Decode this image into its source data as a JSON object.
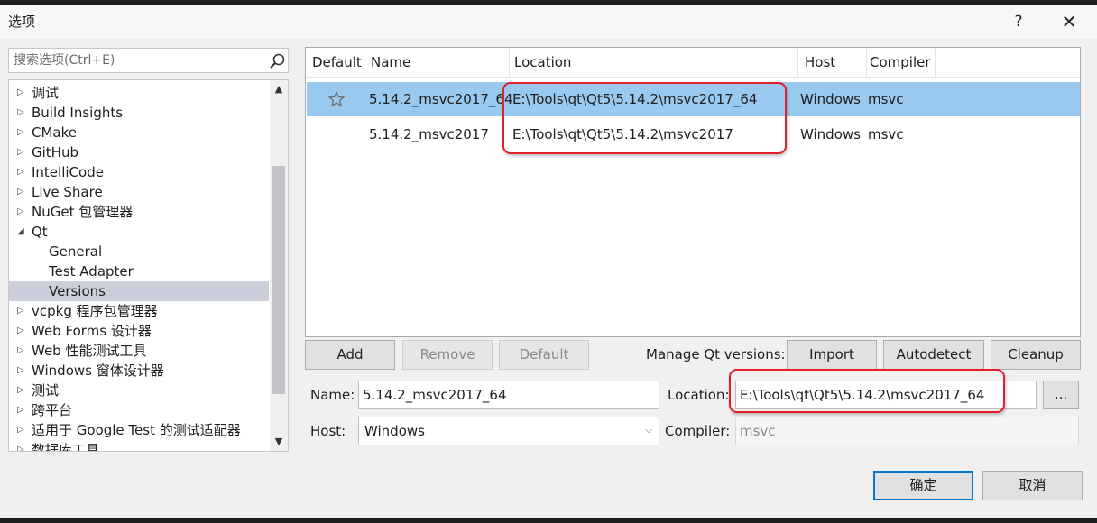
{
  "window": {
    "title": "选项",
    "help": "?",
    "close": "✕"
  },
  "search": {
    "placeholder": "搜索选项(Ctrl+E)"
  },
  "tree": {
    "items": [
      {
        "label": "调试",
        "arrow": "▷"
      },
      {
        "label": "Build Insights",
        "arrow": "▷"
      },
      {
        "label": "CMake",
        "arrow": "▷"
      },
      {
        "label": "GitHub",
        "arrow": "▷"
      },
      {
        "label": "IntelliCode",
        "arrow": "▷"
      },
      {
        "label": "Live Share",
        "arrow": "▷"
      },
      {
        "label": "NuGet 包管理器",
        "arrow": "▷"
      },
      {
        "label": "Qt",
        "arrow": "◢"
      },
      {
        "label": "General"
      },
      {
        "label": "Test Adapter"
      },
      {
        "label": "Versions"
      },
      {
        "label": "vcpkg 程序包管理器",
        "arrow": "▷"
      },
      {
        "label": "Web Forms 设计器",
        "arrow": "▷"
      },
      {
        "label": "Web 性能测试工具",
        "arrow": "▷"
      },
      {
        "label": "Windows 窗体设计器",
        "arrow": "▷"
      },
      {
        "label": "测试",
        "arrow": "▷"
      },
      {
        "label": "跨平台",
        "arrow": "▷"
      },
      {
        "label": "适用于 Google Test 的测试适配器",
        "arrow": "▷"
      },
      {
        "label": "数据库工具",
        "arrow": "▷"
      }
    ],
    "scroll_up": "▲",
    "scroll_down": "▼"
  },
  "table": {
    "headers": [
      "Default",
      "Name",
      "Location",
      "Host",
      "Compiler"
    ],
    "rows": [
      {
        "name": "5.14.2_msvc2017_64",
        "location": "E:\\Tools\\qt\\Qt5\\5.14.2\\msvc2017_64",
        "host": "Windows",
        "compiler": "msvc",
        "is_default": true
      },
      {
        "name": "5.14.2_msvc2017",
        "location": "E:\\Tools\\qt\\Qt5\\5.14.2\\msvc2017",
        "host": "Windows",
        "compiler": "msvc",
        "is_default": false
      }
    ]
  },
  "actions": {
    "add": "Add",
    "remove": "Remove",
    "default": "Default",
    "manage_label": "Manage Qt versions:",
    "import": "Import",
    "autodetect": "Autodetect",
    "cleanup": "Cleanup"
  },
  "form": {
    "name_label": "Name:",
    "name_value": "5.14.2_msvc2017_64",
    "location_label": "Location:",
    "location_value": "E:\\Tools\\qt\\Qt5\\5.14.2\\msvc2017_64",
    "browse": "...",
    "host_label": "Host:",
    "host_value": "Windows",
    "host_arrow": "⌵",
    "compiler_label": "Compiler:",
    "compiler_value": "msvc"
  },
  "footer": {
    "ok": "确定",
    "cancel": "取消"
  },
  "colors": {
    "selection": "#99c9ef",
    "tree_selection": "#cccedb",
    "highlight": "#e0202a",
    "primary_border": "#0078d7"
  }
}
